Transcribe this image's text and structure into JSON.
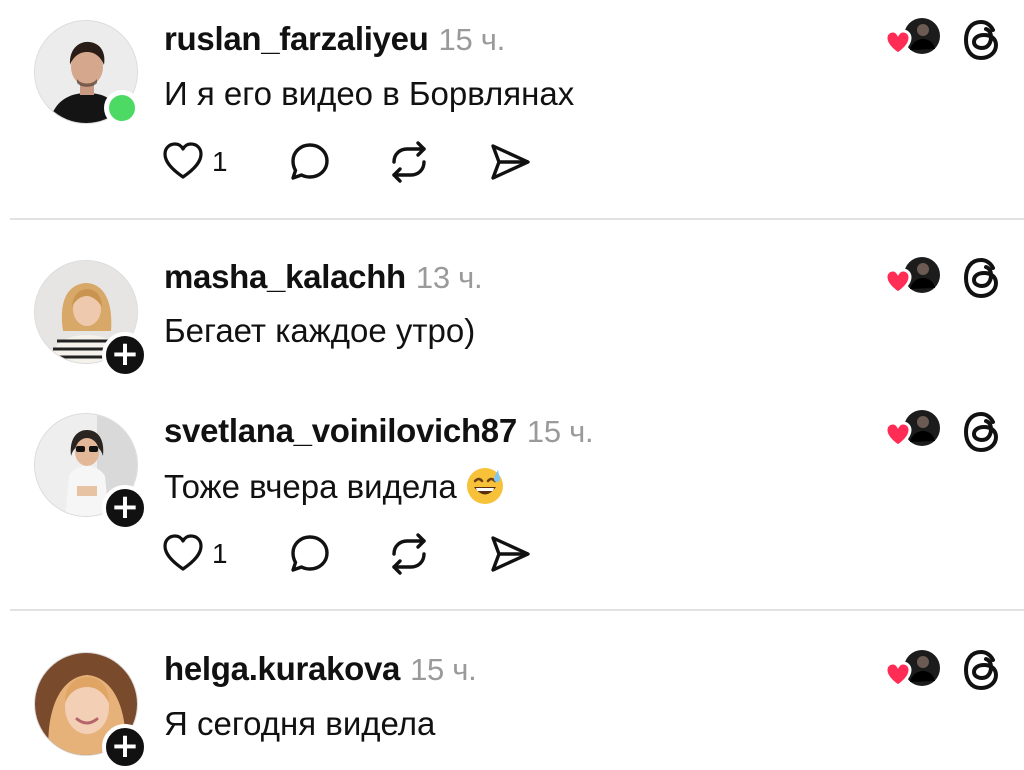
{
  "comments": [
    {
      "username": "ruslan_farzaliyeu",
      "time": "15 ч.",
      "text": "И я его видео в Борвлянах",
      "likes": "1",
      "badge": "online",
      "avatar": "photo-man-black-shirt"
    },
    {
      "username": "masha_kalachh",
      "time": "13 ч.",
      "text": "Бегает каждое утро)",
      "badge": "follow",
      "avatar": "photo-woman-striped-sweater"
    },
    {
      "username": "svetlana_voinilovich87",
      "time": "15 ч.",
      "text": "Тоже вчера видела",
      "emoji": "sweat-smile-emoji",
      "likes": "1",
      "badge": "follow",
      "avatar": "photo-woman-white-outfit"
    },
    {
      "username": "helga.kurakova",
      "time": "15 ч.",
      "text": "Я сегодня видела",
      "badge": "follow",
      "avatar": "photo-woman-blonde"
    }
  ],
  "icons": {
    "like": "heart-outline-icon",
    "reply": "comment-bubble-icon",
    "repost": "repost-icon",
    "share": "send-icon",
    "liked_by_author": "liked-by-author-icon",
    "threads": "threads-logo-icon"
  },
  "colors": {
    "online": "#4cd964",
    "heart": "#ff2d55",
    "divider": "#e2e2e2",
    "timestamp": "#9a9a9a"
  }
}
